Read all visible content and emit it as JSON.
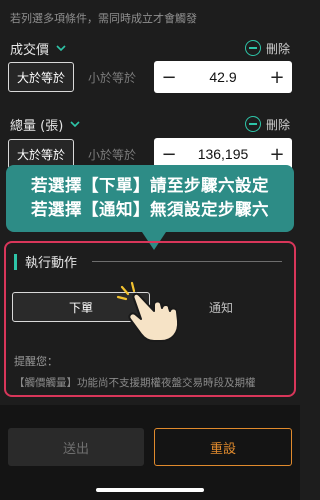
{
  "top_hint": "若列選多項條件，需同時成立才會觸發",
  "conditions": [
    {
      "title": "成交價",
      "delete_label": "刪除",
      "active_option": "大於等於",
      "inactive_option": "小於等於",
      "value": "42.9",
      "minus": "−",
      "plus": "+"
    },
    {
      "title": "總量 (張)",
      "delete_label": "刪除",
      "active_option": "大於等於",
      "inactive_option": "小於等於",
      "value": "136,195",
      "minus": "−",
      "plus": "+"
    }
  ],
  "callout": {
    "line1": "若選擇【下單】請至步驟六設定",
    "line2": "若選擇【通知】無須設定步驟六"
  },
  "action": {
    "title": "執行動作",
    "options": [
      "下單",
      "通知"
    ],
    "selected": "下單",
    "reminder_label": "提醒您：",
    "reminder_text": "【觸價觸量】功能尚不支援期權夜盤交易時段及期權"
  },
  "footer": {
    "submit_label": "送出",
    "reset_label": "重設"
  },
  "colors": {
    "accent": "#2ec5a8",
    "callout_bg": "#2d8c86",
    "highlight_border": "#d8365a",
    "reset": "#e08a2d"
  }
}
